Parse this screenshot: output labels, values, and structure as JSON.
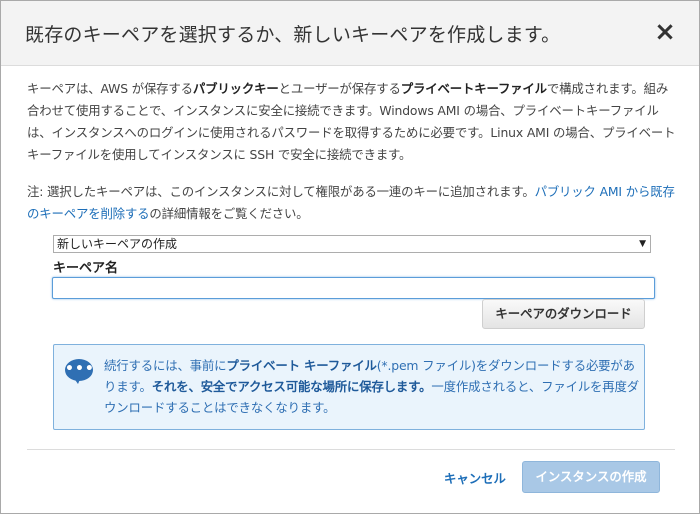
{
  "dialog": {
    "title": "既存のキーペアを選択するか、新しいキーペアを作成します。",
    "close_symbol": "×"
  },
  "description": {
    "p1_a": "キーペアは、AWS が保存する",
    "p1_b": "パブリックキー",
    "p1_c": "とユーザーが保存する",
    "p1_d": "プライベートキーファイル",
    "p1_e": "で構成されます。組み合わせて使用することで、インスタンスに安全に接続できます。Windows AMI の場合、プライベートキーファイルは、インスタンスへのログインに使用されるパスワードを取得するために必要です。Linux AMI の場合、プライベートキーファイルを使用してインスタンスに SSH で安全に接続できます。"
  },
  "note": {
    "text_a": "注: 選択したキーペアは、このインスタンスに対して権限がある一連のキーに追加されます。",
    "link": "パブリック AMI から既存のキーペアを削除する",
    "text_b": "の詳細情報をご覧ください。"
  },
  "keypair_select": {
    "selected": "新しいキーペアの作成",
    "arrow": "▼"
  },
  "keypair_name": {
    "label": "キーペア名",
    "value": ""
  },
  "download_button": "キーペアのダウンロード",
  "info": {
    "icon": "speech-bubble-icon",
    "dots": "•••",
    "a": "続行するには、事前に",
    "b": "プライベート キーファイル",
    "c": "(*.pem ファイル)をダウンロードする必要があります。",
    "d": "それを、安全でアクセス可能な場所に保存します。",
    "e": "一度作成されると、ファイルを再度ダウンロードすることはできなくなります。"
  },
  "footer": {
    "cancel": "キャンセル",
    "create": "インスタンスの作成"
  },
  "colors": {
    "link": "#1d6eb8",
    "info_bg": "#eaf4fc",
    "info_border": "#7fb1dd",
    "primary_disabled": "#a9c8e6"
  }
}
